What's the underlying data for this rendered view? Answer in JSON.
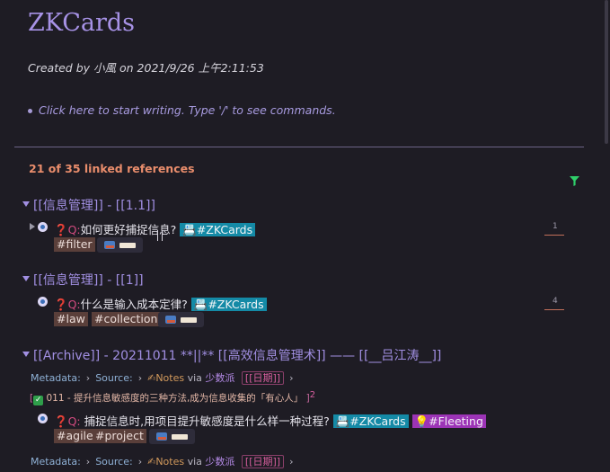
{
  "page": {
    "title": "ZKCards",
    "created": "Created by 小風 on 2021/9/26 上午2:11:53",
    "hint": "Click here to start writing. Type '/' to see commands.",
    "linked_count": "21 of 35 linked references"
  },
  "groups": [
    {
      "heading": "[[信息管理]] - [[1.1]]",
      "q_mark": "❓",
      "q_label": "Q:",
      "question": "如何更好捕捉信息?",
      "tags_inline": [
        "📇#ZKCards"
      ],
      "tags": [
        "#filter"
      ],
      "count": "1"
    },
    {
      "heading": "[[信息管理]] - [[1]]",
      "q_mark": "❓",
      "q_label": "Q:",
      "question": "什么是输入成本定律?",
      "tags_inline": [
        "📇#ZKCards"
      ],
      "tags": [
        "#law",
        "#collection"
      ],
      "count": "4"
    },
    {
      "heading": "[[Archive]] - 20211011 **||** [[高效信息管理术]] —— [[__吕江涛__]]",
      "meta": {
        "label": "Metadata:",
        "source": "Source:",
        "notes": "✍Notes",
        "via": "via",
        "shao": "少数派",
        "date": "[[日期]]"
      },
      "block": {
        "check": "✓",
        "text": "011 - 提升信息敏感度的三种方法,成为信息收集的「有心人」",
        "sup": "2"
      },
      "q_mark": "❓",
      "q_label": "Q:",
      "question": " 捕捉信息时,用项目提升敏感度是什么样一种过程?",
      "tags_inline": [
        "📇#ZKCards",
        "💡#Fleeting"
      ],
      "tags": [
        "#agile",
        "#project"
      ]
    }
  ],
  "colors": {
    "background": "#1e1c24",
    "accent": "#a792e6",
    "linked_count": "#e98d6c",
    "tag_zkcards": "#148aa6",
    "tag_fleeting": "#9c34b6"
  }
}
